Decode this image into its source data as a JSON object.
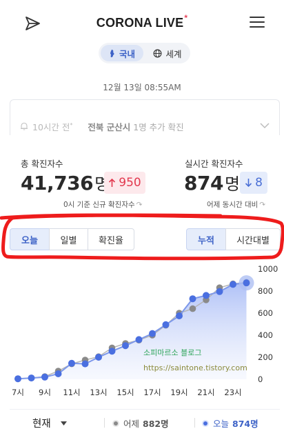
{
  "header": {
    "brand_main": "CORONA",
    "brand_live": "LIVE",
    "brand_mark": "*"
  },
  "region": {
    "domestic_label": "국내",
    "world_label": "세계"
  },
  "timestamp": "12월 13일 08:55AM",
  "news": {
    "time": "10시간 전",
    "time_mark": "*",
    "place": "전북 군산시",
    "text": " 1명 추가 확진"
  },
  "stats": {
    "total_label": "총 확진자수",
    "total_value": "41,736",
    "total_unit": "명",
    "total_delta": "950",
    "total_note": "0시 기준 신규 확진자수",
    "live_label": "실시간 확진자수",
    "live_value": "874",
    "live_unit": "명",
    "live_delta": "8",
    "live_note": "어제 동시간 대비"
  },
  "tabs_left": [
    "오늘",
    "일별",
    "확진율"
  ],
  "tabs_right": [
    "누적",
    "시간대별"
  ],
  "watermark": {
    "line1": "소피마르소 블로그",
    "line2": "https://saintone.tistory.com"
  },
  "bottom": {
    "period": "현재",
    "yesterday_label": "어제",
    "yesterday_value": "882명",
    "today_label": "오늘",
    "today_value": "874명"
  },
  "colors": {
    "today": "#4a6fe0",
    "yesterday": "#8a8a8a",
    "accent_red": "#e8445a",
    "scribble": "#ee1c1c"
  },
  "chart_data": {
    "type": "line",
    "categories": [
      "7시",
      "8시",
      "9시",
      "10시",
      "11시",
      "12시",
      "13시",
      "14시",
      "15시",
      "16시",
      "17시",
      "18시",
      "19시",
      "20시",
      "21시",
      "22시",
      "23시",
      "24시"
    ],
    "x_tick_labels": [
      "7시",
      "9시",
      "11시",
      "13시",
      "15시",
      "17시",
      "19시",
      "21시",
      "23시"
    ],
    "y_tick_labels": [
      "0",
      "200",
      "400",
      "600",
      "800",
      "1000"
    ],
    "ylim": [
      0,
      1000
    ],
    "series": [
      {
        "name": "어제",
        "values": [
          5,
          12,
          25,
          75,
          140,
          175,
          205,
          285,
          325,
          355,
          400,
          490,
          600,
          640,
          720,
          830,
          865,
          880
        ]
      },
      {
        "name": "오늘",
        "values": [
          5,
          12,
          20,
          50,
          145,
          140,
          200,
          255,
          305,
          360,
          415,
          495,
          575,
          730,
          760,
          795,
          860,
          874
        ]
      }
    ]
  }
}
